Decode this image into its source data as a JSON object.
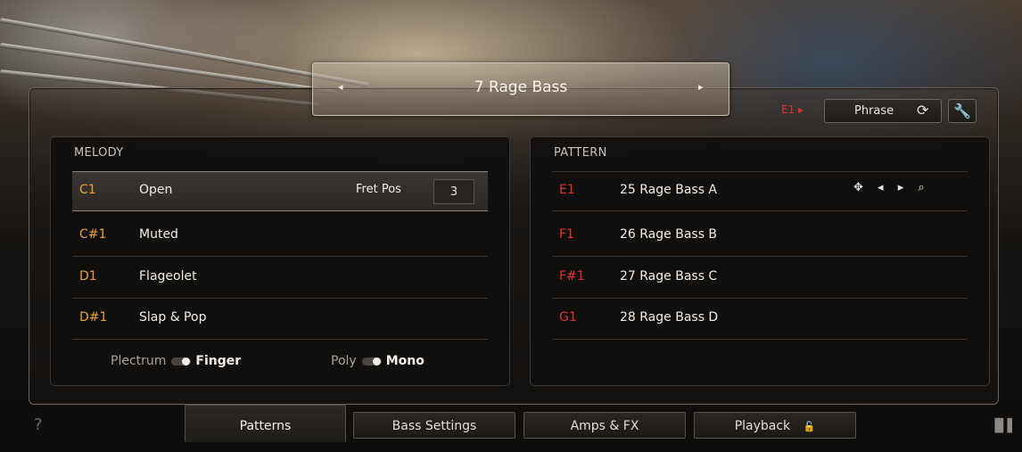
{
  "preset": {
    "prev": "◂",
    "name": "7  Rage Bass",
    "next": "▸"
  },
  "header": {
    "key_indicator": "E1 ▸",
    "phrase_label": "Phrase",
    "phrase_icon": "⟳",
    "wrench_icon": "🔧"
  },
  "melody": {
    "title": "MELODY",
    "fret_label": "Fret Pos",
    "fret_value": "3",
    "rows": [
      {
        "key": "C1",
        "name": "Open"
      },
      {
        "key": "C#1",
        "name": "Muted"
      },
      {
        "key": "D1",
        "name": "Flageolet"
      },
      {
        "key": "D#1",
        "name": "Slap & Pop"
      }
    ],
    "toggle1": {
      "off": "Plectrum",
      "on": "Finger"
    },
    "toggle2": {
      "off": "Poly",
      "on": "Mono"
    }
  },
  "pattern": {
    "title": "PATTERN",
    "tools": {
      "move": "✥",
      "prev": "◂",
      "next": "▸",
      "search": "⌕"
    },
    "rows": [
      {
        "key": "E1",
        "name": "25  Rage Bass A"
      },
      {
        "key": "F1",
        "name": "26  Rage Bass B"
      },
      {
        "key": "F#1",
        "name": "27  Rage Bass C"
      },
      {
        "key": "G1",
        "name": "28  Rage Bass D"
      }
    ]
  },
  "tabs": [
    {
      "label": "Patterns"
    },
    {
      "label": "Bass Settings"
    },
    {
      "label": "Amps & FX"
    },
    {
      "label": "Playback",
      "icon": "🔓"
    }
  ],
  "footer": {
    "help": "?",
    "keyboard": "▐▌▌"
  },
  "colors": {
    "accent_red": "#e0332c",
    "accent_orange": "#e8a033"
  }
}
